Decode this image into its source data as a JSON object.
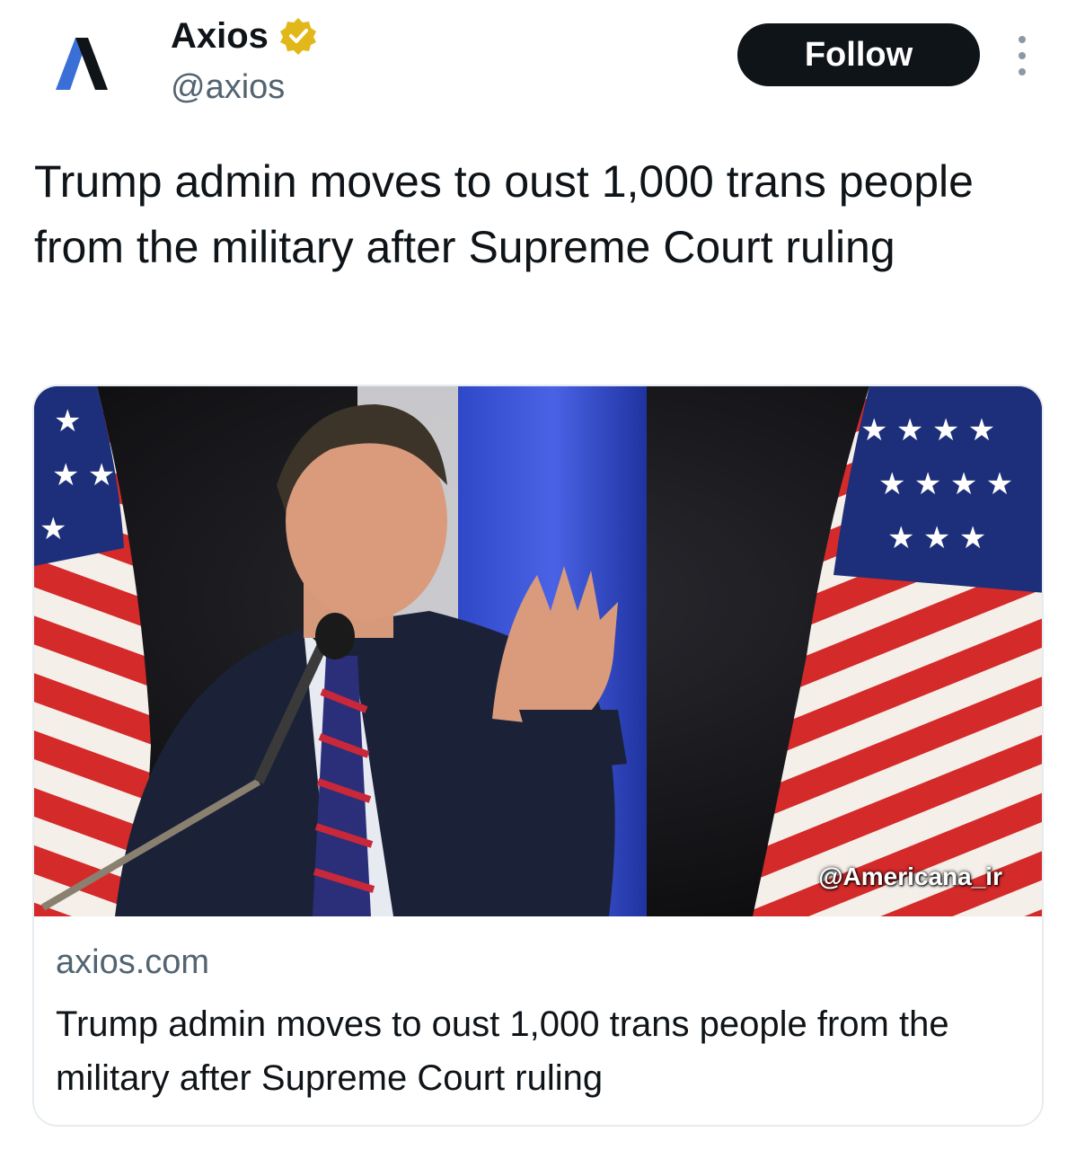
{
  "account": {
    "display_name": "Axios",
    "handle": "@axios",
    "verified": true
  },
  "actions": {
    "follow_label": "Follow"
  },
  "tweet": {
    "text": "Trump admin moves to oust 1,000 trans people from the military after Supreme Court ruling"
  },
  "link_card": {
    "domain": "axios.com",
    "title": "Trump admin moves to oust 1,000 trans people from the military after Supreme Court ruling",
    "image_watermark": "@Americana_ir"
  },
  "icons": {
    "avatar": "axios-logo-icon",
    "verified": "verified-badge-icon",
    "more": "more-options-icon"
  },
  "colors": {
    "text": "#0f1419",
    "secondary_text": "#536471",
    "verified_gold": "#e2b719",
    "follow_bg": "#0f1419",
    "logo_blue": "#3b6fd8"
  }
}
